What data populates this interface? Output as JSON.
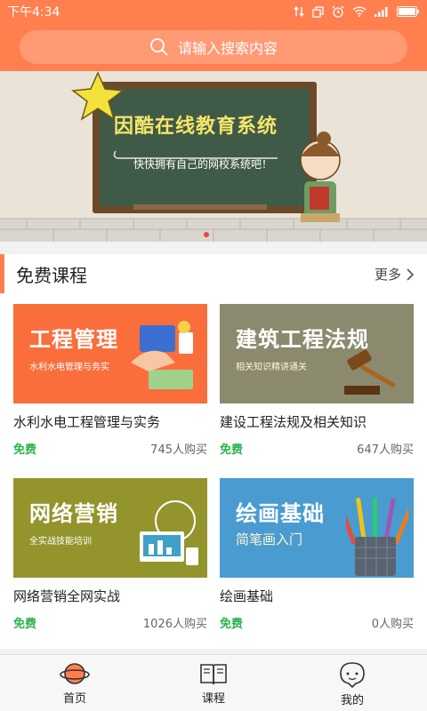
{
  "status": {
    "time": "下午4:34"
  },
  "search": {
    "placeholder": "请输入搜索内容"
  },
  "banner": {
    "title": "因酷在线教育系统",
    "subtitle": "快快拥有自己的网校系统吧！"
  },
  "section": {
    "title": "免费课程",
    "more": "更多"
  },
  "courses": [
    {
      "thumb_title": "工程管理",
      "thumb_sub": "水利水电管理与务实",
      "name": "水利水电工程管理与实务",
      "price": "免费",
      "buyers": "745人购买",
      "bg": "#fa6e3c"
    },
    {
      "thumb_title": "建筑工程法规",
      "thumb_sub": "相关知识精讲通关",
      "name": "建设工程法规及相关知识",
      "price": "免费",
      "buyers": "647人购买",
      "bg": "#8c8a6e"
    },
    {
      "thumb_title": "网络营销",
      "thumb_sub": "全实战技能培训",
      "name": "网络营销全网实战",
      "price": "免费",
      "buyers": "1026人购买",
      "bg": "#94942c"
    },
    {
      "thumb_title": "绘画基础",
      "thumb_sub": "简笔画入门",
      "name": "绘画基础",
      "price": "免费",
      "buyers": "0人购买",
      "bg": "#4a9bd0"
    }
  ],
  "tabs": [
    {
      "label": "首页",
      "icon": "home-planet-icon"
    },
    {
      "label": "课程",
      "icon": "book-icon"
    },
    {
      "label": "我的",
      "icon": "profile-icon"
    }
  ],
  "colors": {
    "brand": "#ff7f4f",
    "free": "#2bb24c"
  }
}
